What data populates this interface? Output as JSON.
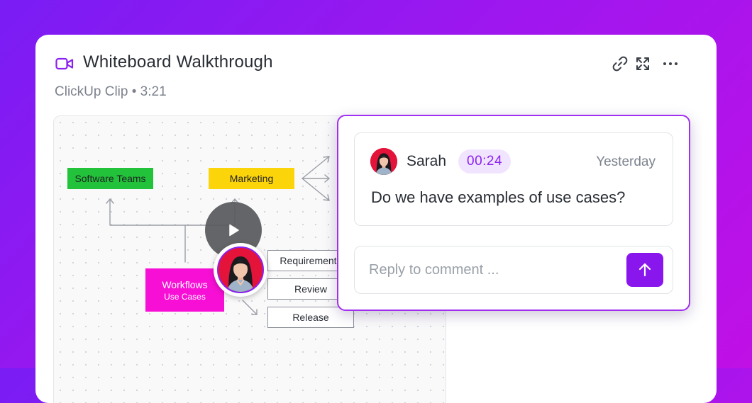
{
  "clip": {
    "title": "Whiteboard Walkthrough",
    "subtitle": "ClickUp Clip • 3:21"
  },
  "toolbar": {
    "icons": [
      "link-icon",
      "expand-icon",
      "more-icon"
    ]
  },
  "whiteboard": {
    "stickies": {
      "software_teams": "Software Teams",
      "marketing": "Marketing",
      "workflows_line1": "Workflows",
      "workflows_line2": "Use Cases"
    },
    "boxes": [
      "Requirements",
      "Review",
      "Release"
    ]
  },
  "comment": {
    "author": "Sarah",
    "timestamp": "00:24",
    "when": "Yesterday",
    "text": "Do we have examples of use cases?"
  },
  "reply": {
    "placeholder": "Reply to comment ..."
  },
  "colors": {
    "accent": "#8a16ee",
    "green_sticky": "#22c33a",
    "yellow_sticky": "#fcd40a",
    "pink_sticky": "#f80fd5"
  }
}
